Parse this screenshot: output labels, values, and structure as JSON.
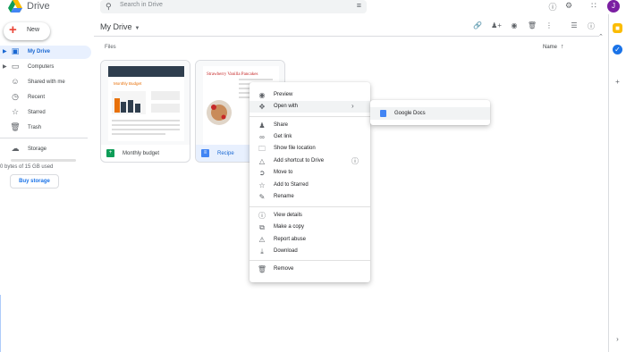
{
  "app": {
    "name": "Drive",
    "user_initial": "J"
  },
  "search": {
    "placeholder": "Search in Drive"
  },
  "colors": {
    "accent": "#1a73e8",
    "active_bg": "#e8f0fe",
    "doc_blue": "#4285f4",
    "sheets_green": "#0f9d58"
  },
  "sidebar": {
    "new_label": "New",
    "items": [
      {
        "label": "My Drive",
        "icon": "drive-icon",
        "active": true
      },
      {
        "label": "Computers",
        "icon": "computer-icon"
      },
      {
        "label": "Shared with me",
        "icon": "people-icon"
      },
      {
        "label": "Recent",
        "icon": "clock-icon"
      },
      {
        "label": "Starred",
        "icon": "star-icon"
      },
      {
        "label": "Trash",
        "icon": "trash-icon"
      }
    ],
    "storage_label": "Storage",
    "storage_used": "0 bytes of 15 GB used",
    "storage_fraction": 0,
    "buy_label": "Buy storage"
  },
  "main": {
    "breadcrumb": "My Drive",
    "files_label": "Files",
    "sort_label": "Name",
    "files": [
      {
        "name": "Monthly budget",
        "type": "sheets",
        "icon": "sheets-icon"
      },
      {
        "name": "Recipe",
        "type": "docs",
        "icon": "docs-icon",
        "selected": true
      }
    ],
    "thumb_text": {
      "budget_title": "Monthly Budget",
      "recipe_title": "Strawberry Vanilla Pancakes"
    }
  },
  "context_menu": {
    "groups": [
      [
        {
          "label": "Preview",
          "icon": "eye-icon"
        },
        {
          "label": "Open with",
          "icon": "open-with-icon",
          "submenu": true,
          "highlighted": true
        }
      ],
      [
        {
          "label": "Share",
          "icon": "share-icon"
        },
        {
          "label": "Get link",
          "icon": "link-icon"
        },
        {
          "label": "Show file location",
          "icon": "folder-icon"
        },
        {
          "label": "Add shortcut to Drive",
          "icon": "shortcut-icon",
          "help": true
        },
        {
          "label": "Move to",
          "icon": "move-icon"
        },
        {
          "label": "Add to Starred",
          "icon": "star-icon"
        },
        {
          "label": "Rename",
          "icon": "pencil-icon"
        }
      ],
      [
        {
          "label": "View details",
          "icon": "info-icon"
        },
        {
          "label": "Make a copy",
          "icon": "copy-icon"
        },
        {
          "label": "Report abuse",
          "icon": "report-icon"
        },
        {
          "label": "Download",
          "icon": "download-icon"
        }
      ],
      [
        {
          "label": "Remove",
          "icon": "trash-icon"
        }
      ]
    ]
  },
  "submenu": {
    "items": [
      {
        "label": "Google Docs",
        "icon": "docs-icon"
      }
    ]
  }
}
